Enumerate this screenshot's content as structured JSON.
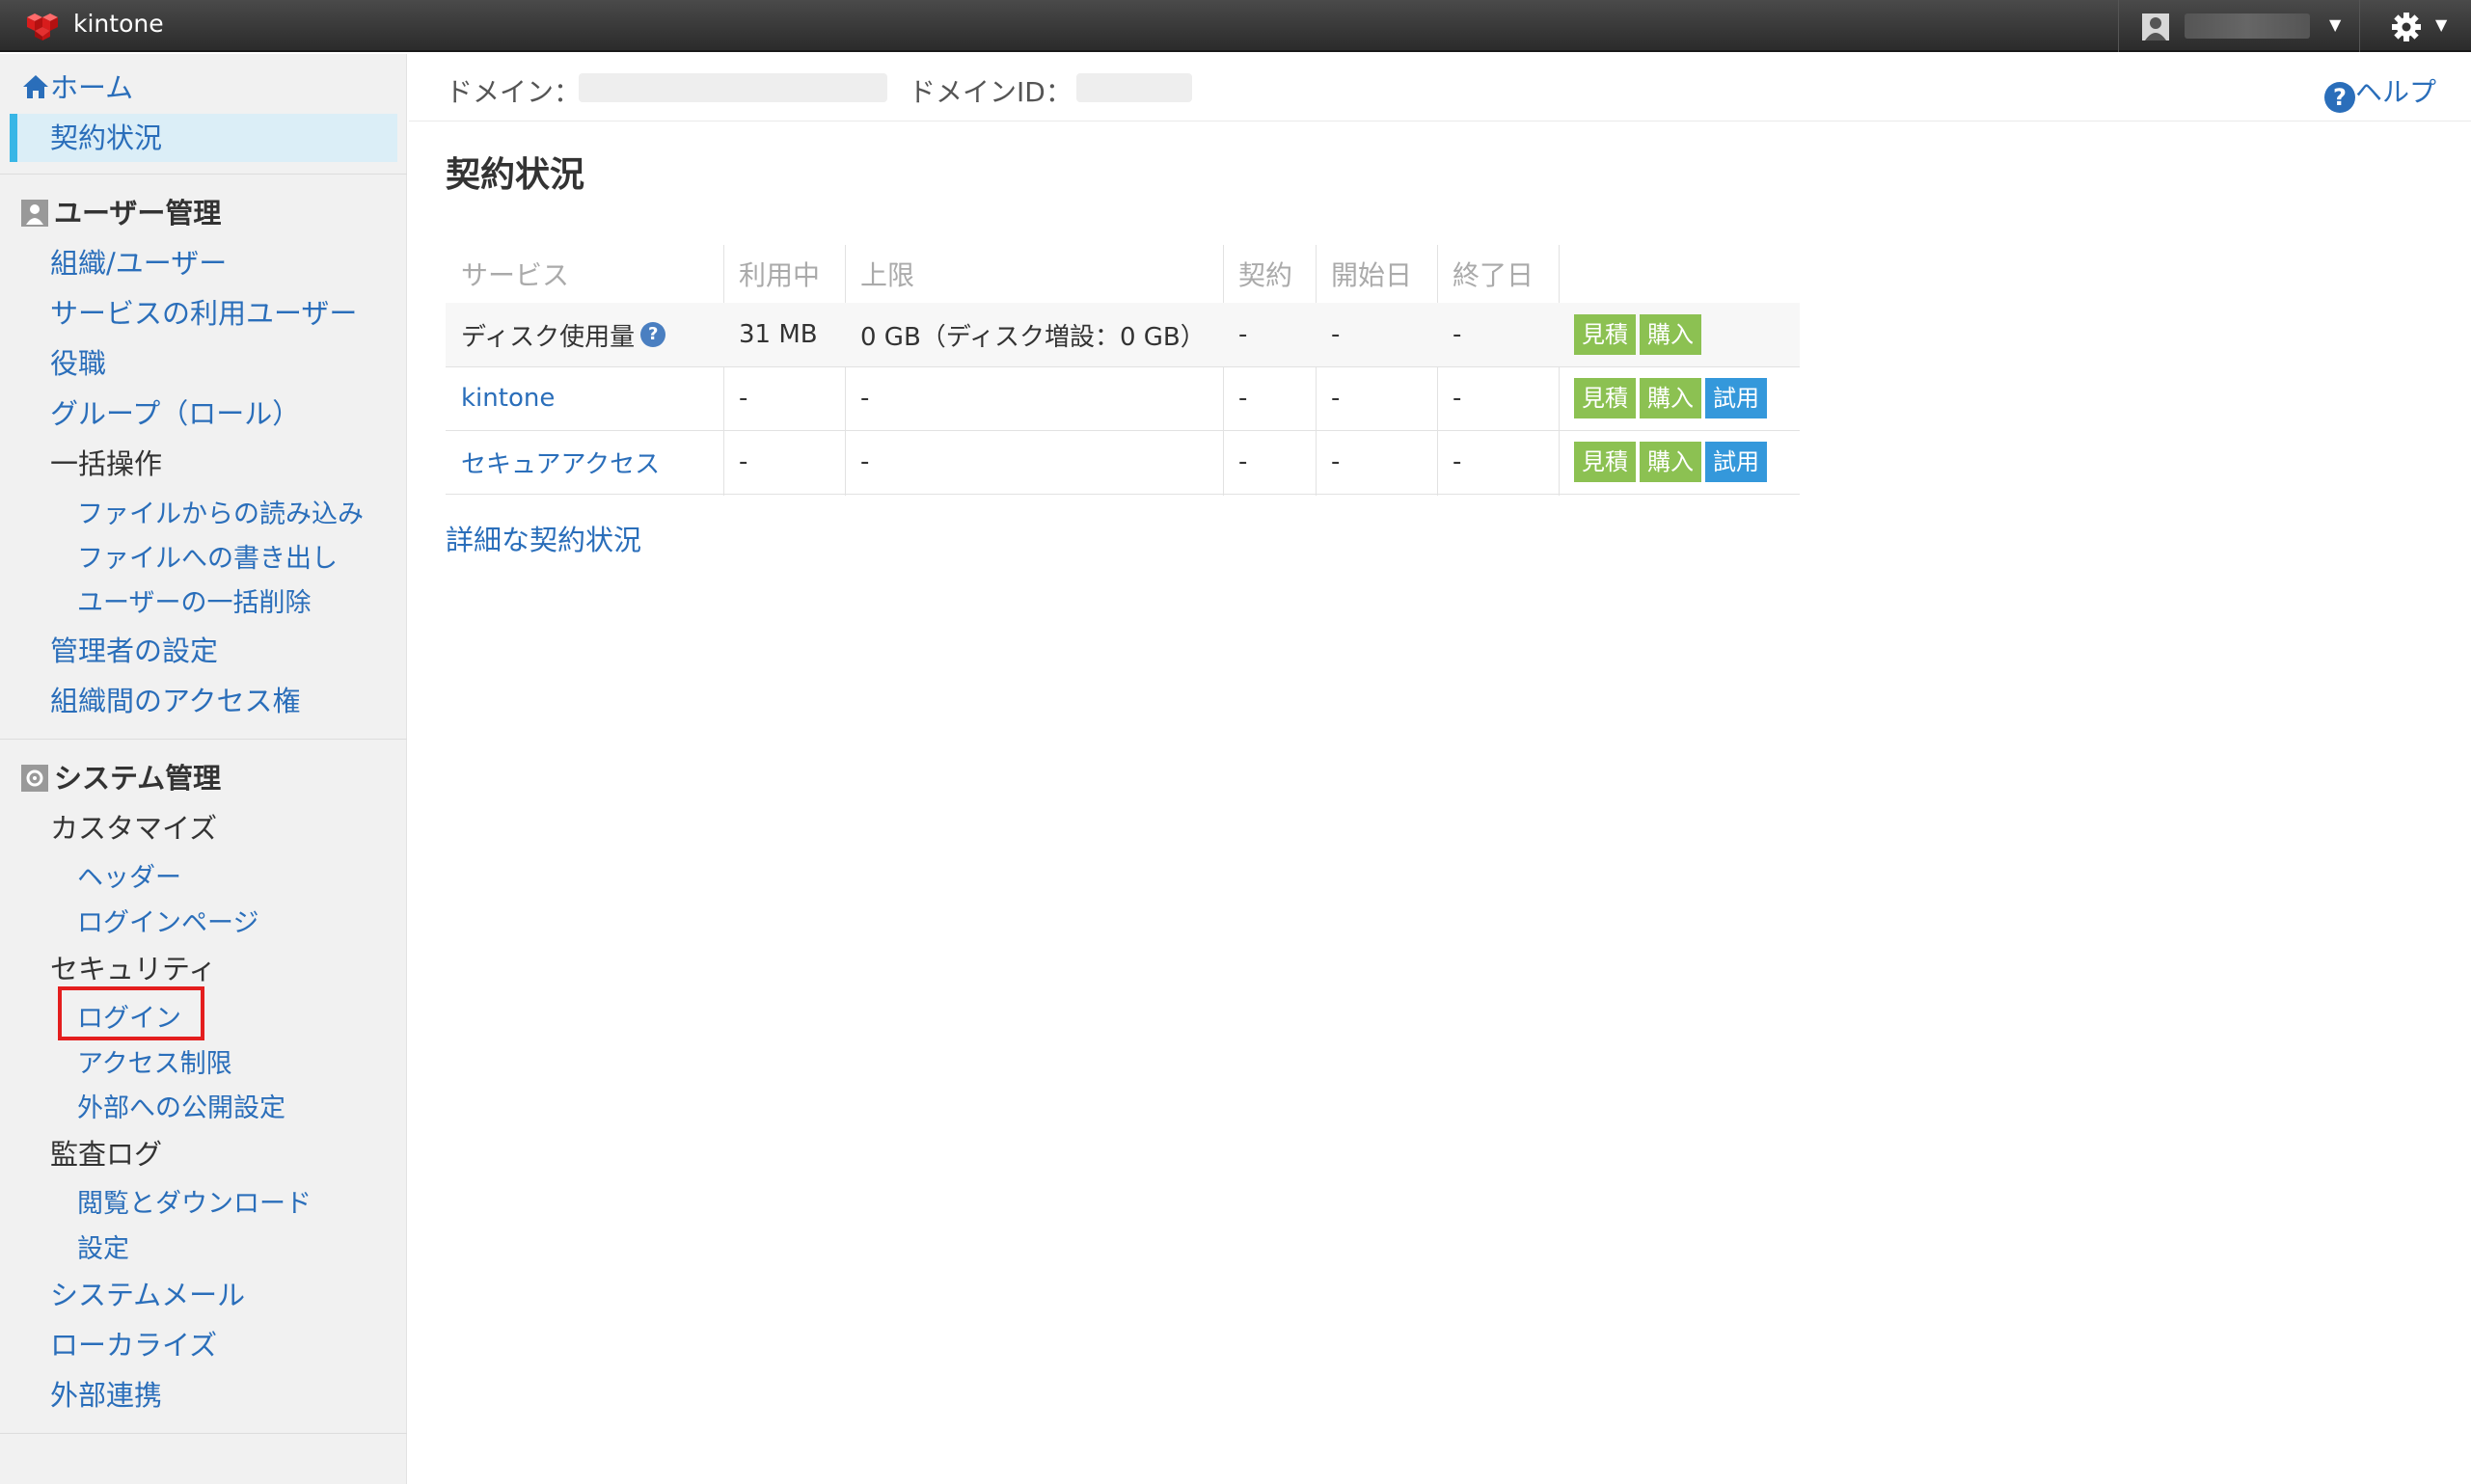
{
  "header": {
    "brand": "kintone"
  },
  "sidebar": {
    "home": "ホーム",
    "contract": "契約状況",
    "user_mgmt": {
      "title": "ユーザー管理",
      "items": [
        "組織/ユーザー",
        "サービスの利用ユーザー",
        "役職",
        "グループ（ロール）"
      ],
      "bulk": "一括操作",
      "bulk_items": [
        "ファイルからの読み込み",
        "ファイルへの書き出し",
        "ユーザーの一括削除"
      ],
      "admin": "管理者の設定",
      "access": "組織間のアクセス権"
    },
    "system_mgmt": {
      "title": "システム管理",
      "customize": "カスタマイズ",
      "customize_items": [
        "ヘッダー",
        "ログインページ"
      ],
      "security": "セキュリティ",
      "security_items": [
        "ログイン",
        "アクセス制限",
        "外部への公開設定"
      ],
      "audit": "監査ログ",
      "audit_items": [
        "閲覧とダウンロード",
        "設定"
      ],
      "others": [
        "システムメール",
        "ローカライズ",
        "外部連携"
      ]
    }
  },
  "top": {
    "domain_label": "ドメイン：",
    "domain_id_label": "ドメインID：",
    "help": "ヘルプ"
  },
  "page_title": "契約状況",
  "table": {
    "headers": [
      "サービス",
      "利用中",
      "上限",
      "契約",
      "開始日",
      "終了日"
    ],
    "rows": [
      {
        "service": "ディスク使用量",
        "used": "31 MB",
        "limit": "0 GB（ディスク増設：0 GB）",
        "contract": "-",
        "start": "-",
        "end": "-",
        "buttons": [
          "見積",
          "購入"
        ]
      },
      {
        "service": "kintone",
        "used": "-",
        "limit": "-",
        "contract": "-",
        "start": "-",
        "end": "-",
        "buttons": [
          "見積",
          "購入",
          "試用"
        ]
      },
      {
        "service": "セキュアアクセス",
        "used": "-",
        "limit": "-",
        "contract": "-",
        "start": "-",
        "end": "-",
        "buttons": [
          "見積",
          "購入",
          "試用"
        ]
      }
    ]
  },
  "detail_link": "詳細な契約状況",
  "colors": {
    "accent": "#2a6eba",
    "green_button": "#8cc152",
    "blue_button": "#3498db",
    "highlight": "#e41e1e"
  }
}
